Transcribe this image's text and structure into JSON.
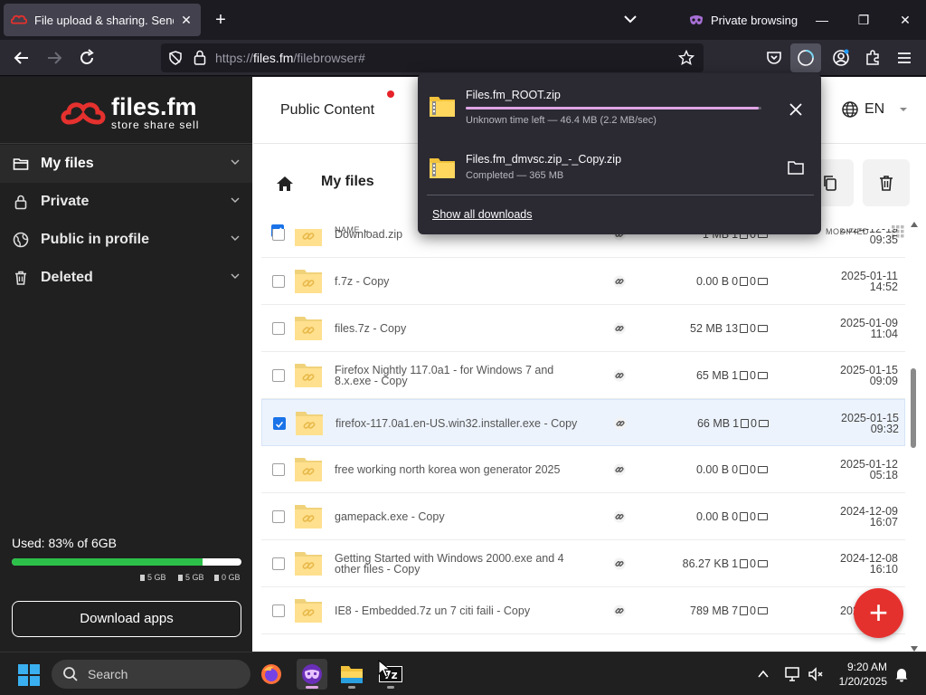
{
  "browser": {
    "tab_title": "File upload & sharing. Send large files",
    "private_label": "Private browsing",
    "url_prefix": "https://",
    "url_host": "files.fm",
    "url_path": "/filebrowser#"
  },
  "sidebar": {
    "logo_name": "files.fm",
    "logo_tagline": "store share sell",
    "items": [
      {
        "label": "My files"
      },
      {
        "label": "Private"
      },
      {
        "label": "Public in profile"
      },
      {
        "label": "Deleted"
      }
    ],
    "usage_text": "Used: 83% of 6GB",
    "usage_percent": 83,
    "legend": [
      "5 GB",
      "5 GB",
      "0 GB"
    ],
    "download_apps": "Download apps"
  },
  "topnav": {
    "public_content": "Public Content",
    "language": "EN"
  },
  "breadcrumb": {
    "title": "My files"
  },
  "table": {
    "col_name": "NAME",
    "col_modified": "MODIFIED",
    "rows": [
      {
        "name": "Download.zip",
        "size": "1 MB",
        "files": "1",
        "folders": "0",
        "date": "2024-12-19",
        "time": "09:35",
        "selected": false
      },
      {
        "name": "f.7z - Copy",
        "size": "0.00  B",
        "files": "0",
        "folders": "0",
        "date": "2025-01-11",
        "time": "14:52",
        "selected": false
      },
      {
        "name": "files.7z - Copy",
        "size": "52 MB",
        "files": "13",
        "folders": "0",
        "date": "2025-01-09",
        "time": "11:04",
        "selected": false
      },
      {
        "name": "Firefox Nightly 117.0a1 - for Windows 7 and 8.x.exe - Copy",
        "size": "65 MB",
        "files": "1",
        "folders": "0",
        "date": "2025-01-15",
        "time": "09:09",
        "selected": false
      },
      {
        "name": "firefox-117.0a1.en-US.win32.installer.exe - Copy",
        "size": "66 MB",
        "files": "1",
        "folders": "0",
        "date": "2025-01-15",
        "time": "09:32",
        "selected": true
      },
      {
        "name": "free working north korea won generator 2025",
        "size": "0.00  B",
        "files": "0",
        "folders": "0",
        "date": "2025-01-12",
        "time": "05:18",
        "selected": false
      },
      {
        "name": "gamepack.exe - Copy",
        "size": "0.00  B",
        "files": "0",
        "folders": "0",
        "date": "2024-12-09",
        "time": "16:07",
        "selected": false
      },
      {
        "name": "Getting Started with Windows 2000.exe and 4 other files - Copy",
        "size": "86.27 KB",
        "files": "1",
        "folders": "0",
        "date": "2024-12-08",
        "time": "16:10",
        "selected": false
      },
      {
        "name": "IE8 - Embedded.7z un 7 citi faili - Copy",
        "size": "789 MB",
        "files": "7",
        "folders": "0",
        "date": "2024-12-08",
        "time": "",
        "selected": false
      }
    ]
  },
  "downloads": {
    "items": [
      {
        "name": "Files.fm_ROOT.zip",
        "status": "Unknown time left — 46.4 MB (2.2 MB/sec)",
        "progress": 0.99
      },
      {
        "name": "Files.fm_dmvsc.zip_-_Copy.zip",
        "status": "Completed — 365 MB"
      }
    ],
    "show_all": "Show all downloads"
  },
  "taskbar": {
    "search_label": "Search",
    "time": "9:20 AM",
    "date": "1/20/2025"
  },
  "colors": {
    "accent_red": "#e5312e",
    "usage_green": "#2cc04a",
    "select_blue": "#1a73e8",
    "download_progress": "#e0a5e5"
  }
}
